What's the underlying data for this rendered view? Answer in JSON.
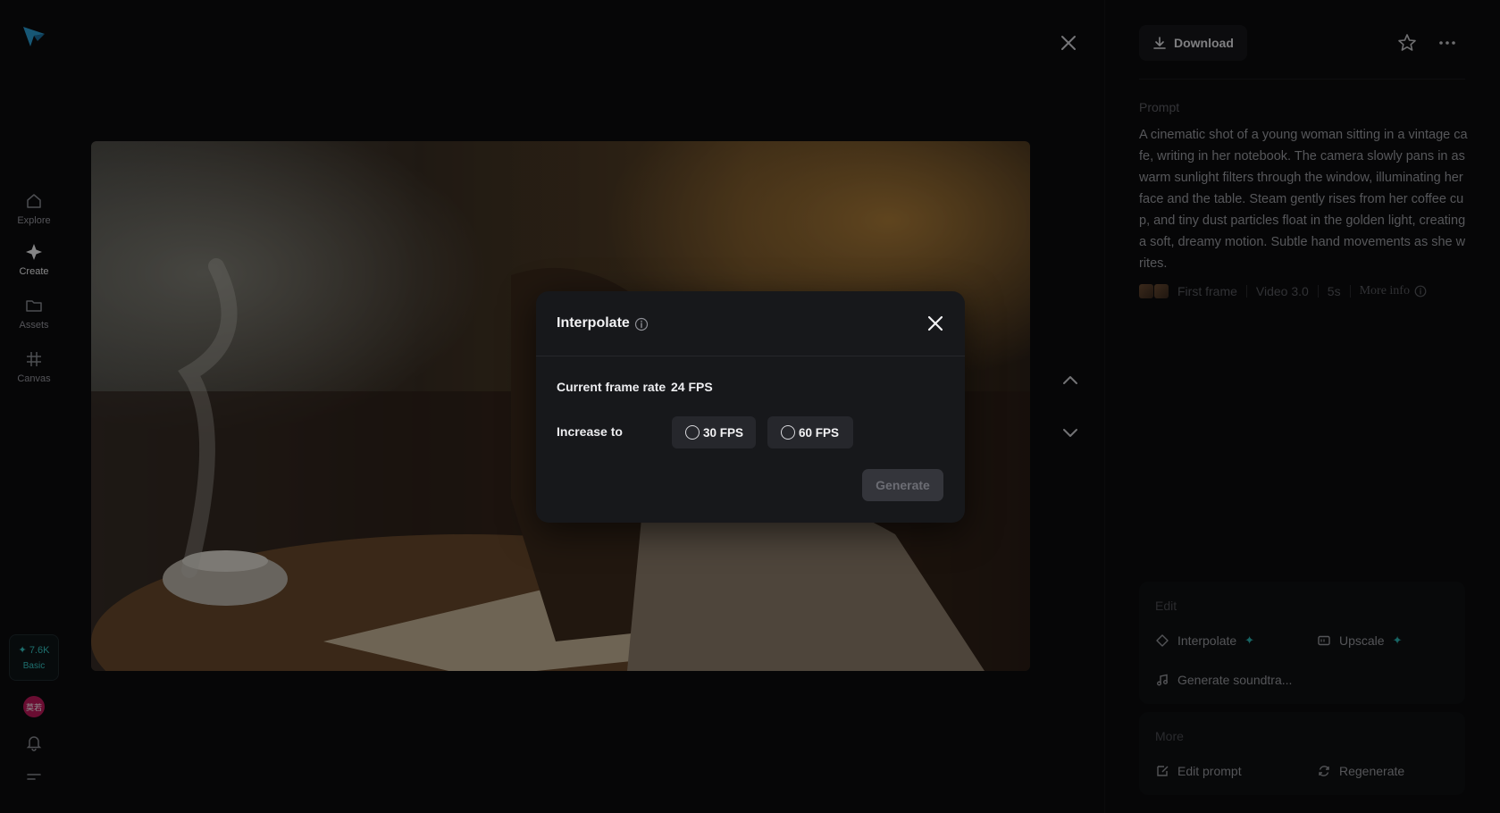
{
  "nav": {
    "items": [
      {
        "label": "Explore",
        "icon": "home-icon"
      },
      {
        "label": "Create",
        "icon": "sparkle-icon"
      },
      {
        "label": "Assets",
        "icon": "folder-icon"
      },
      {
        "label": "Canvas",
        "icon": "grid-icon"
      }
    ],
    "credits": {
      "amount": "7.6K",
      "plan": "Basic"
    },
    "avatar_initials": "莫若"
  },
  "toolbar": {
    "download_label": "Download"
  },
  "prompt": {
    "label": "Prompt",
    "text": "A cinematic shot of a young woman sitting in a vintage cafe, writing in her notebook. The camera slowly pans in as warm sunlight filters through the window, illuminating her face and the table. Steam gently rises from her coffee cup, and tiny dust particles float in the golden light, creating a soft, dreamy motion. Subtle hand movements as she writes."
  },
  "meta": {
    "first_frame": "First frame",
    "model": "Video 3.0",
    "duration": "5s",
    "more_info": "More info"
  },
  "edit": {
    "title": "Edit",
    "interpolate": "Interpolate",
    "upscale": "Upscale",
    "soundtrack": "Generate soundtra..."
  },
  "more": {
    "title": "More",
    "edit_prompt": "Edit prompt",
    "regenerate": "Regenerate"
  },
  "modal": {
    "title": "Interpolate",
    "current_label": "Current frame rate",
    "current_value": "24 FPS",
    "increase_label": "Increase to",
    "options": [
      "30 FPS",
      "60 FPS"
    ],
    "generate_label": "Generate"
  },
  "colors": {
    "accent": "#2bb7b5",
    "background": "#0b0b0d",
    "modal": "#17181b"
  }
}
